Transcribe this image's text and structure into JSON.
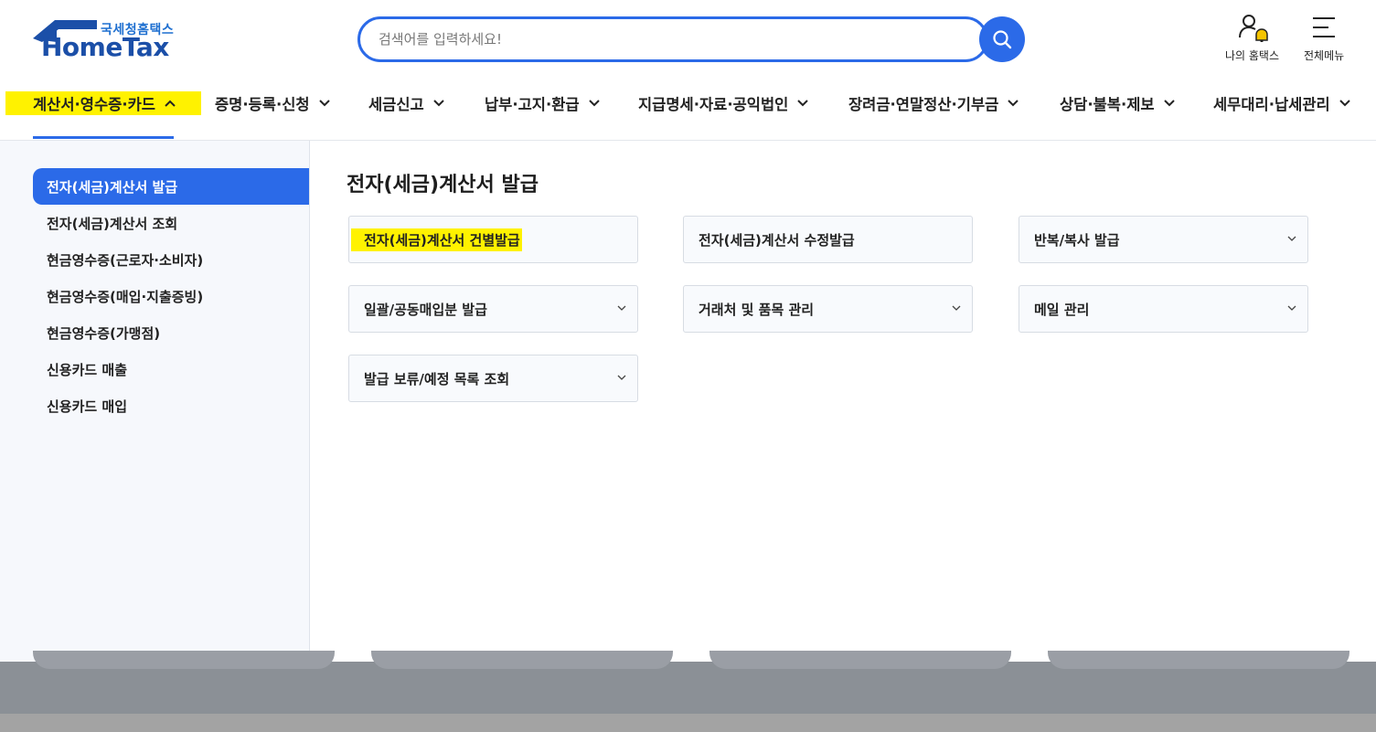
{
  "logo": {
    "sub_text": "국세청홈택스",
    "main_text": "HomeTax"
  },
  "search": {
    "placeholder": "검색어를 입력하세요!",
    "value": ""
  },
  "utility": {
    "my_hometax": "나의 홈택스",
    "full_menu": "전체메뉴"
  },
  "gnb": {
    "items": [
      {
        "label": "계산서·영수증·카드",
        "expanded": true
      },
      {
        "label": "증명·등록·신청",
        "expanded": false
      },
      {
        "label": "세금신고",
        "expanded": false
      },
      {
        "label": "납부·고지·환급",
        "expanded": false
      },
      {
        "label": "지급명세·자료·공익법인",
        "expanded": false
      },
      {
        "label": "장려금·연말정산·기부금",
        "expanded": false
      },
      {
        "label": "상담·불복·제보",
        "expanded": false
      },
      {
        "label": "세무대리·납세관리",
        "expanded": false
      }
    ]
  },
  "sidebar": {
    "items": [
      {
        "label": "전자(세금)계산서 발급",
        "active": true
      },
      {
        "label": "전자(세금)계산서 조회"
      },
      {
        "label": "현금영수증(근로자·소비자)"
      },
      {
        "label": "현금영수증(매입·지출증빙)"
      },
      {
        "label": "현금영수증(가맹점)"
      },
      {
        "label": "신용카드 매출"
      },
      {
        "label": "신용카드 매입"
      }
    ]
  },
  "content": {
    "title": "전자(세금)계산서 발급",
    "cards": [
      {
        "label": "전자(세금)계산서 건별발급",
        "has_dropdown": false,
        "highlighted": true
      },
      {
        "label": "전자(세금)계산서 수정발급",
        "has_dropdown": false
      },
      {
        "label": "반복/복사 발급",
        "has_dropdown": true
      },
      {
        "label": "일괄/공동매입분 발급",
        "has_dropdown": true
      },
      {
        "label": "거래처 및 품목 관리",
        "has_dropdown": true
      },
      {
        "label": "메일 관리",
        "has_dropdown": true
      },
      {
        "label": "발급 보류/예정 목록 조회",
        "has_dropdown": true
      }
    ]
  },
  "colors": {
    "brand_blue": "#2b6ae8",
    "highlight": "#fff200",
    "logo_navy": "#1b4fa8",
    "bell": "#f5c400"
  }
}
